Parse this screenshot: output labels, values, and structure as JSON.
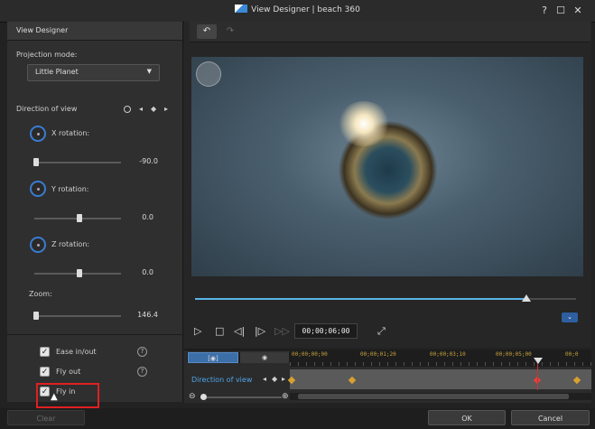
{
  "window": {
    "title": "View Designer  |  beach 360",
    "help": "?",
    "maximize": "☐",
    "close": "✕"
  },
  "left": {
    "header": "View Designer",
    "projection_label": "Projection mode:",
    "projection_value": "Little Planet",
    "direction_label": "Direction of view",
    "x_label": "X rotation:",
    "x_value": "-90.0",
    "x_fraction": 0.0,
    "y_label": "Y rotation:",
    "y_value": "0.0",
    "y_fraction": 0.5,
    "z_label": "Z rotation:",
    "z_value": "0.0",
    "z_fraction": 0.5,
    "zoom_label": "Zoom:",
    "zoom_value": "146.4",
    "zoom_fraction": 0.0,
    "ease": "Ease in/out",
    "flyout": "Fly out",
    "flyin": "Fly in",
    "help": "?"
  },
  "player": {
    "timecode": "00;00;06;00",
    "progress": 0.87
  },
  "timeline": {
    "track_label": "Direction of view",
    "tab1": "[◉]",
    "ticks": [
      "00;00;00;00",
      "00;00;01;20",
      "00;00;03;10",
      "00;00;05;00",
      "00;0"
    ]
  },
  "buttons": {
    "clear": "Clear",
    "ok": "OK",
    "cancel": "Cancel"
  }
}
